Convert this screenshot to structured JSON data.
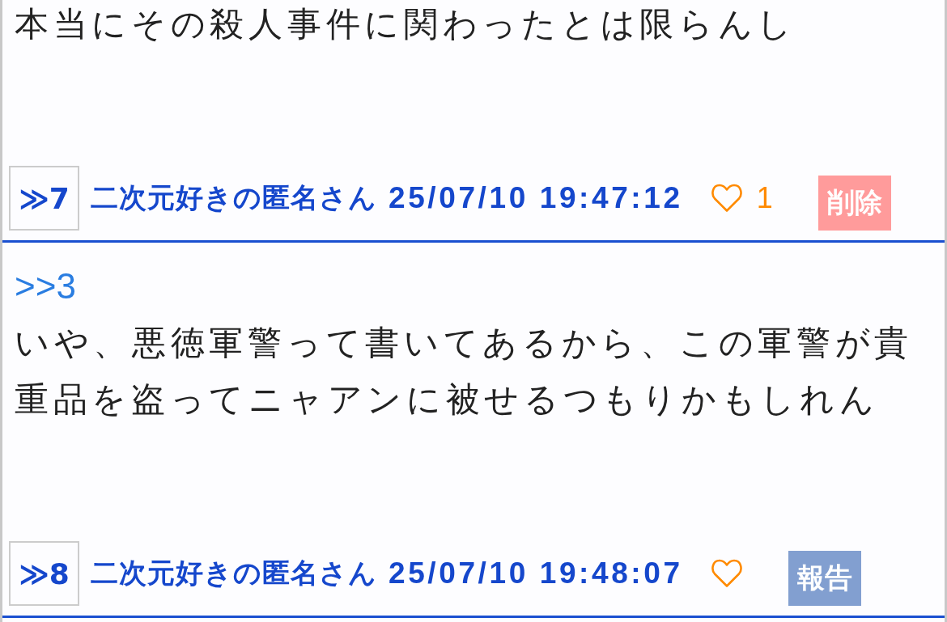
{
  "posts": [
    {
      "body": "本当にその殺人事件に関わったとは限らんし",
      "number": "≫7",
      "name": "二次元好きの匿名さん",
      "date": "25/07/10 19:47:12",
      "liked": false,
      "likes": "1",
      "action": {
        "kind": "delete",
        "label": "削除"
      }
    },
    {
      "reply_to": ">>3",
      "body": "いや、悪徳軍警って書いてあるから、この軍警が貴重品を盗ってニャアンに被せるつもりかもしれん",
      "number": "≫8",
      "name": "二次元好きの匿名さん",
      "date": "25/07/10 19:48:07",
      "liked": false,
      "action": {
        "kind": "report",
        "label": "報告"
      }
    }
  ]
}
